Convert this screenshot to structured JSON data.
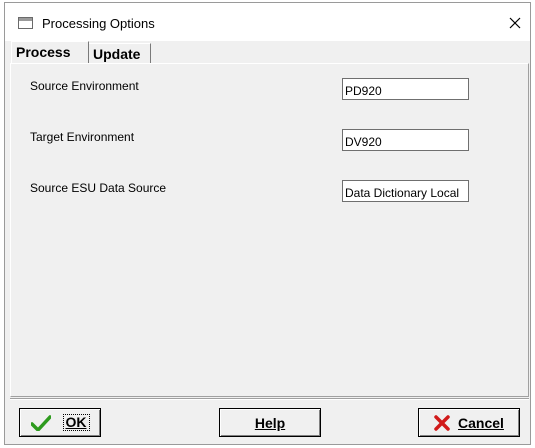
{
  "window": {
    "title": "Processing Options"
  },
  "tabs": [
    {
      "label": "Process",
      "active": true
    },
    {
      "label": "Update",
      "active": false
    }
  ],
  "fields": [
    {
      "label": "Source Environment",
      "value": "PD920"
    },
    {
      "label": "Target Environment",
      "value": "DV920"
    },
    {
      "label": "Source ESU Data Source",
      "value": "Data Dictionary Local"
    }
  ],
  "buttons": {
    "ok_label": "OK",
    "help_label": "Help",
    "cancel_label": "Cancel"
  },
  "icons": {
    "window": "window-icon",
    "close": "close-icon",
    "ok": "checkmark-icon",
    "cancel": "red-x-icon"
  },
  "colors": {
    "checkmark": "#2e9b1e",
    "cancel_x": "#d11a1a",
    "dialog_bg": "#f0f0f0"
  }
}
